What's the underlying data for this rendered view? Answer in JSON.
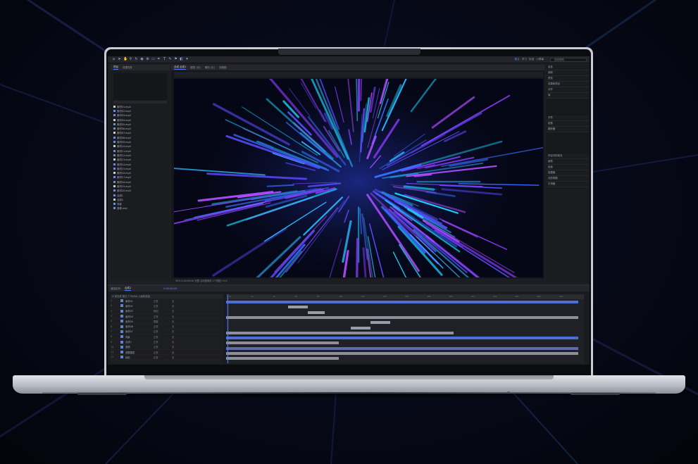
{
  "toolbar": {
    "tools": [
      "selection",
      "hand",
      "zoom",
      "rotate",
      "camera",
      "pan",
      "rect",
      "pen",
      "text",
      "brush",
      "stamp",
      "eraser",
      "puppet"
    ],
    "workspaces": [
      {
        "label": "默认",
        "active": true
      },
      {
        "label": "学习",
        "active": false
      },
      {
        "label": "标准",
        "active": false
      },
      {
        "label": "小屏幕",
        "active": false
      }
    ],
    "search_placeholder": "搜索帮助"
  },
  "project_panel": {
    "tabs": [
      {
        "label": "项目",
        "active": true
      },
      {
        "label": "效果控件",
        "active": false
      }
    ],
    "files": [
      "素材01.mp4",
      "素材02.mp4",
      "素材03.mp4",
      "素材04.mp4",
      "素材05.mp4",
      "素材06.mp4",
      "素材07.mp4",
      "素材08.mp4",
      "素材09.mp4",
      "素材10.mp4",
      "素材11.mp4",
      "素材12.mp4",
      "素材13.mp4",
      "素材14.mp4",
      "素材15.mp4",
      "素材16.mp4",
      "素材17.mp4",
      "素材18.mp4",
      "素材19.mp4",
      "素材20.mp4",
      "合成1",
      "合成2",
      "背景",
      "音频.wav"
    ]
  },
  "viewer": {
    "tabs": [
      {
        "label": "合成 合成1",
        "active": true
      },
      {
        "label": "图层 (无)",
        "active": false
      },
      {
        "label": "素材 (无)",
        "active": false
      },
      {
        "label": "流程图",
        "active": false
      }
    ],
    "footer": "50%   0:00:00:00   完整   活动摄像机   1个视图   +0.0"
  },
  "properties": {
    "rows": [
      "信息",
      "音频",
      "预览",
      "效果和预设",
      "对齐",
      "库",
      "字符",
      "段落",
      "跟踪器",
      "内容识别填充",
      "画笔",
      "绘画",
      "摇摆器",
      "动态草图",
      "平滑器"
    ]
  },
  "timeline": {
    "tabs": [
      {
        "label": "渲染队列",
        "active": false
      },
      {
        "label": "合成1",
        "active": true
      }
    ],
    "timecode": "0:00:00:00",
    "columns": "#  源名称  模式  T  TrkMat  父级和链接",
    "layers": [
      {
        "n": "1",
        "name": "素材01",
        "mode": "正常",
        "parent": "无"
      },
      {
        "n": "2",
        "name": "素材02",
        "mode": "正常",
        "parent": "无"
      },
      {
        "n": "3",
        "name": "素材03",
        "mode": "相加",
        "parent": "无"
      },
      {
        "n": "4",
        "name": "素材04",
        "mode": "正常",
        "parent": "无"
      },
      {
        "n": "5",
        "name": "素材05",
        "mode": "屏幕",
        "parent": "无"
      },
      {
        "n": "6",
        "name": "素材06",
        "mode": "正常",
        "parent": "无"
      },
      {
        "n": "7",
        "name": "素材07",
        "mode": "正常",
        "parent": "无"
      },
      {
        "n": "8",
        "name": "背景",
        "mode": "正常",
        "parent": "无"
      },
      {
        "n": "9",
        "name": "合成2",
        "mode": "正常",
        "parent": "无"
      },
      {
        "n": "10",
        "name": "音频",
        "mode": "正常",
        "parent": "无"
      },
      {
        "n": "11",
        "name": "调整图层",
        "mode": "正常",
        "parent": "无"
      },
      {
        "n": "12",
        "name": "纯色",
        "mode": "正常",
        "parent": "无"
      }
    ],
    "ruler_ticks": [
      "0s",
      "2s",
      "4s",
      "6s",
      "8s",
      "10s",
      "12s",
      "14s",
      "16s",
      "18s",
      "20s",
      "22s",
      "24s",
      "26s",
      "28s",
      "30s"
    ],
    "playhead_position": 0
  }
}
